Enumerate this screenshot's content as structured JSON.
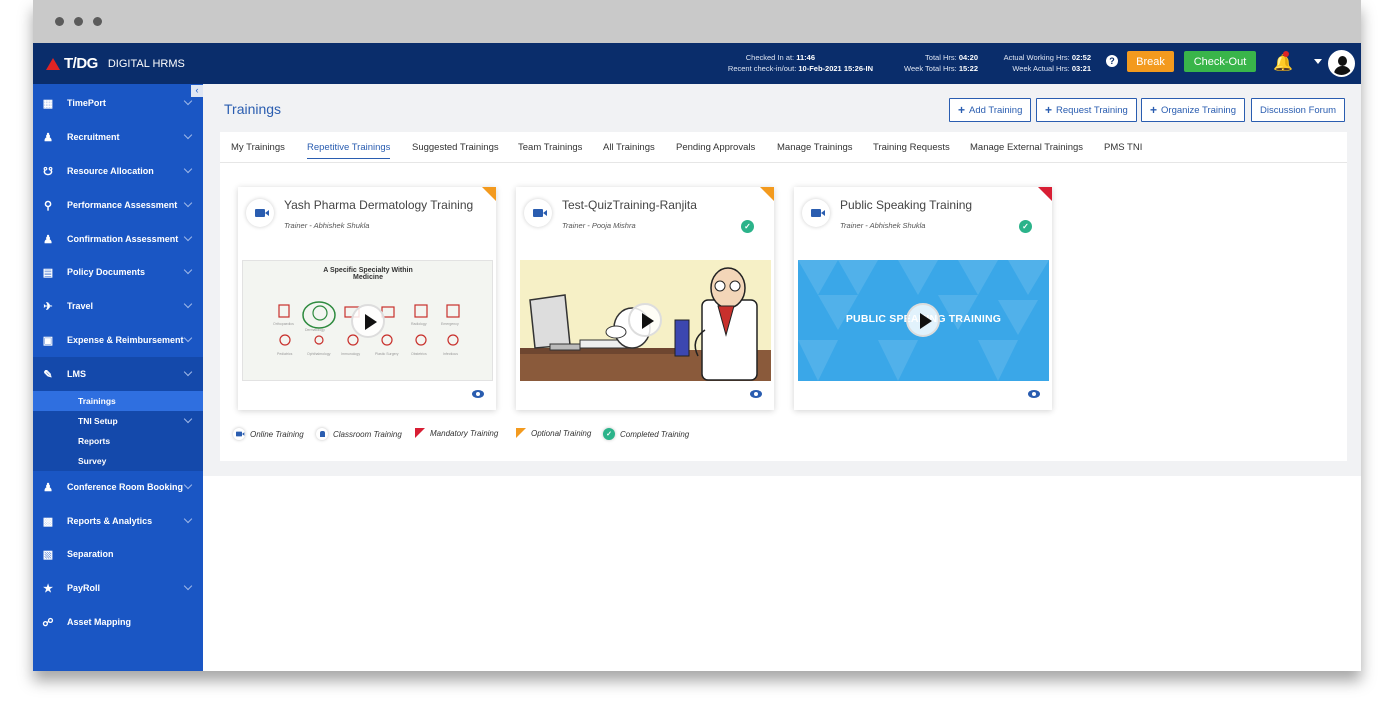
{
  "topbar": {
    "brand": "T/DG",
    "app_name": "DIGITAL HRMS",
    "checked_in_label": "Checked In at:",
    "checked_in_value": "11:46",
    "recent_label": "Recent check-in/out:",
    "recent_value": "10-Feb-2021 15:26-IN",
    "total_hrs_label": "Total Hrs:",
    "total_hrs_value": "04:20",
    "week_total_label": "Week Total Hrs:",
    "week_total_value": "15:22",
    "actual_label": "Actual Working Hrs:",
    "actual_value": "02:52",
    "week_actual_label": "Week Actual Hrs:",
    "week_actual_value": "03:21",
    "break_label": "Break",
    "checkout_label": "Check-Out",
    "help": "?",
    "break_color": "#f39a1e",
    "checkout_color": "#39b54a"
  },
  "sidebar": {
    "collapse": "‹",
    "items": [
      {
        "label": "TimePort",
        "icon": "calendar-icon"
      },
      {
        "label": "Recruitment",
        "icon": "people-icon"
      },
      {
        "label": "Resource Allocation",
        "icon": "network-icon"
      },
      {
        "label": "Performance Assessment",
        "icon": "magnifier-icon"
      },
      {
        "label": "Confirmation Assessment",
        "icon": "user-check-icon"
      },
      {
        "label": "Policy Documents",
        "icon": "document-icon"
      },
      {
        "label": "Travel",
        "icon": "plane-icon"
      },
      {
        "label": "Expense & Reimbursement",
        "icon": "wallet-icon"
      },
      {
        "label": "LMS",
        "icon": "lms-icon"
      },
      {
        "label": "Conference Room Booking",
        "icon": "meeting-icon"
      },
      {
        "label": "Reports & Analytics",
        "icon": "chart-icon"
      },
      {
        "label": "Separation",
        "icon": "exit-icon"
      },
      {
        "label": "PayRoll",
        "icon": "payroll-icon"
      },
      {
        "label": "Asset Mapping",
        "icon": "asset-icon"
      }
    ],
    "lms_sub": [
      "Trainings",
      "TNI Setup",
      "Reports",
      "Survey"
    ]
  },
  "page": {
    "title": "Trainings",
    "add_training": "Add Training",
    "request_training": "Request Training",
    "organize_training": "Organize Training",
    "discussion_forum": "Discussion Forum"
  },
  "tabs": [
    "My Trainings",
    "Repetitive Trainings",
    "Suggested Trainings",
    "Team Trainings",
    "All Trainings",
    "Pending Approvals",
    "Manage Trainings",
    "Training Requests",
    "Manage External Trainings",
    "PMS TNI"
  ],
  "cards": [
    {
      "title": "Yash Pharma Dermatology Training",
      "trainer": "Trainer - Abhishek Shukla",
      "thumb_title": "A Specific Specialty Within Medicine",
      "flag": "optional",
      "completed": false
    },
    {
      "title": "Test-QuizTraining-Ranjita",
      "trainer": "Trainer - Pooja Mishra",
      "flag": "optional",
      "completed": true
    },
    {
      "title": "Public Speaking Training",
      "trainer": "Trainer - Abhishek Shukla",
      "thumb_title": "PUBLIC SPEAKING TRAINING",
      "flag": "mandatory",
      "completed": true
    }
  ],
  "legend": {
    "online": "Online Training",
    "classroom": "Classroom Training",
    "mandatory": "Mandatory Training",
    "optional": "Optional Training",
    "completed": "Completed Training"
  }
}
